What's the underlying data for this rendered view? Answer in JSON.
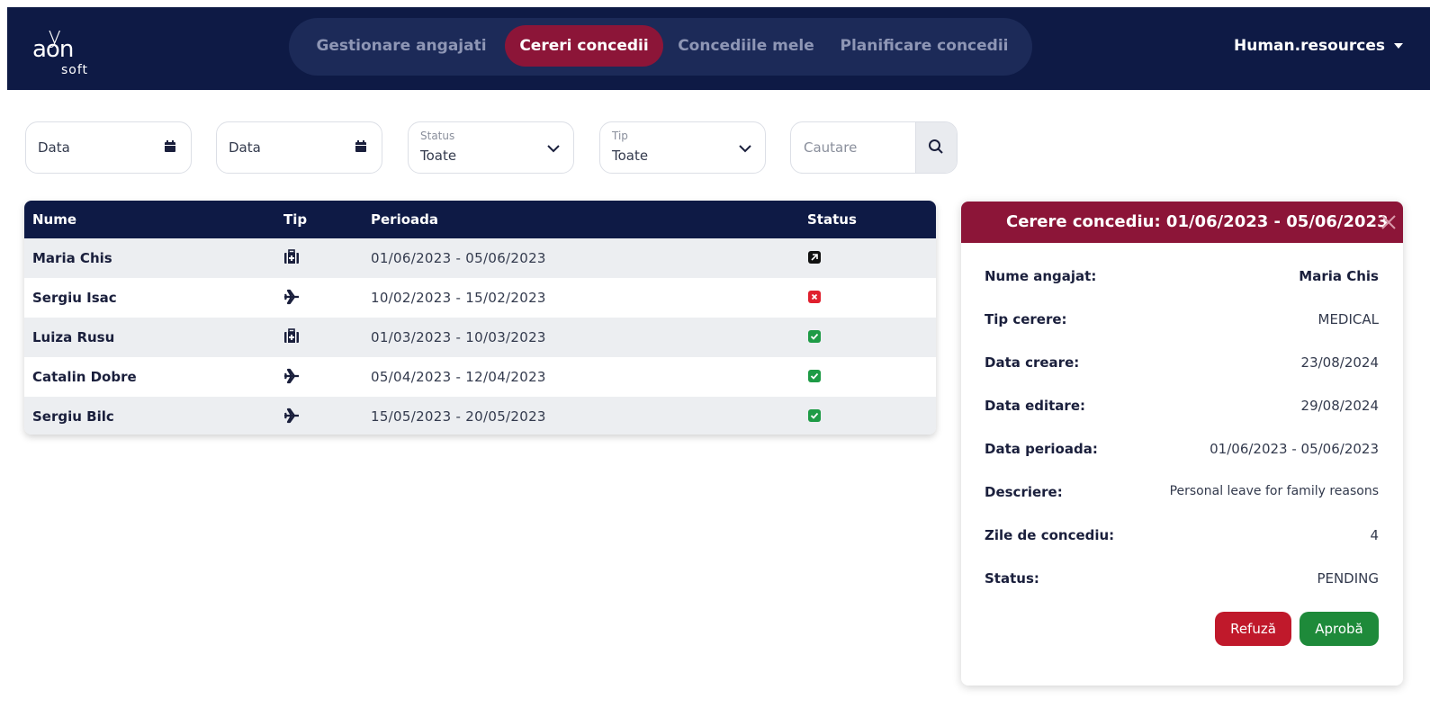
{
  "logo": {
    "main": "aon",
    "x": "y",
    "sub": "soft"
  },
  "nav": {
    "tabs": [
      {
        "label": "Gestionare angajati",
        "active": false
      },
      {
        "label": "Cereri concedii",
        "active": true
      },
      {
        "label": "Concediile mele",
        "active": false
      },
      {
        "label": "Planificare concedii",
        "active": false
      }
    ],
    "user": "Human.resources"
  },
  "filters": {
    "date_from": "Data",
    "date_to": "Data",
    "status": {
      "label": "Status",
      "value": "Toate"
    },
    "type": {
      "label": "Tip",
      "value": "Toate"
    },
    "search_placeholder": "Cautare"
  },
  "table": {
    "headers": {
      "name": "Nume",
      "type": "Tip",
      "period": "Perioada",
      "status": "Status"
    },
    "rows": [
      {
        "name": "Maria Chis",
        "type_icon": "medical-kit-icon",
        "period": "01/06/2023 - 05/06/2023",
        "status_icon": "pending-icon"
      },
      {
        "name": "Sergiu Isac",
        "type_icon": "airplane-icon",
        "period": "10/02/2023 - 15/02/2023",
        "status_icon": "rejected-icon"
      },
      {
        "name": "Luiza Rusu",
        "type_icon": "medical-kit-icon",
        "period": "01/03/2023 - 10/03/2023",
        "status_icon": "approved-icon"
      },
      {
        "name": "Catalin Dobre",
        "type_icon": "airplane-icon",
        "period": "05/04/2023 - 12/04/2023",
        "status_icon": "approved-icon"
      },
      {
        "name": "Sergiu Bilc",
        "type_icon": "airplane-icon",
        "period": "15/05/2023 - 20/05/2023",
        "status_icon": "approved-icon"
      }
    ]
  },
  "detail": {
    "title": "Cerere concediu: 01/06/2023 - 05/06/2023",
    "fields": [
      {
        "label": "Nume angajat:",
        "value": "Maria Chis"
      },
      {
        "label": "Tip cerere:",
        "value": "MEDICAL"
      },
      {
        "label": "Data creare:",
        "value": "23/08/2024"
      },
      {
        "label": "Data editare:",
        "value": "29/08/2024"
      },
      {
        "label": "Data perioada:",
        "value": "01/06/2023 - 05/06/2023"
      },
      {
        "label": "Descriere:",
        "value": "Personal leave for family reasons"
      },
      {
        "label": "Zile de concediu:",
        "value": "4"
      },
      {
        "label": "Status:",
        "value": "PENDING"
      }
    ],
    "reject_label": "Refuză",
    "approve_label": "Aprobă"
  },
  "colors": {
    "navy": "#0e1a45",
    "accent": "#8c1538",
    "reject": "#c0192b",
    "approve": "#1e8a3a",
    "status_approved": "#1e9b46",
    "status_rejected": "#e0202e",
    "status_pending": "#111111"
  }
}
